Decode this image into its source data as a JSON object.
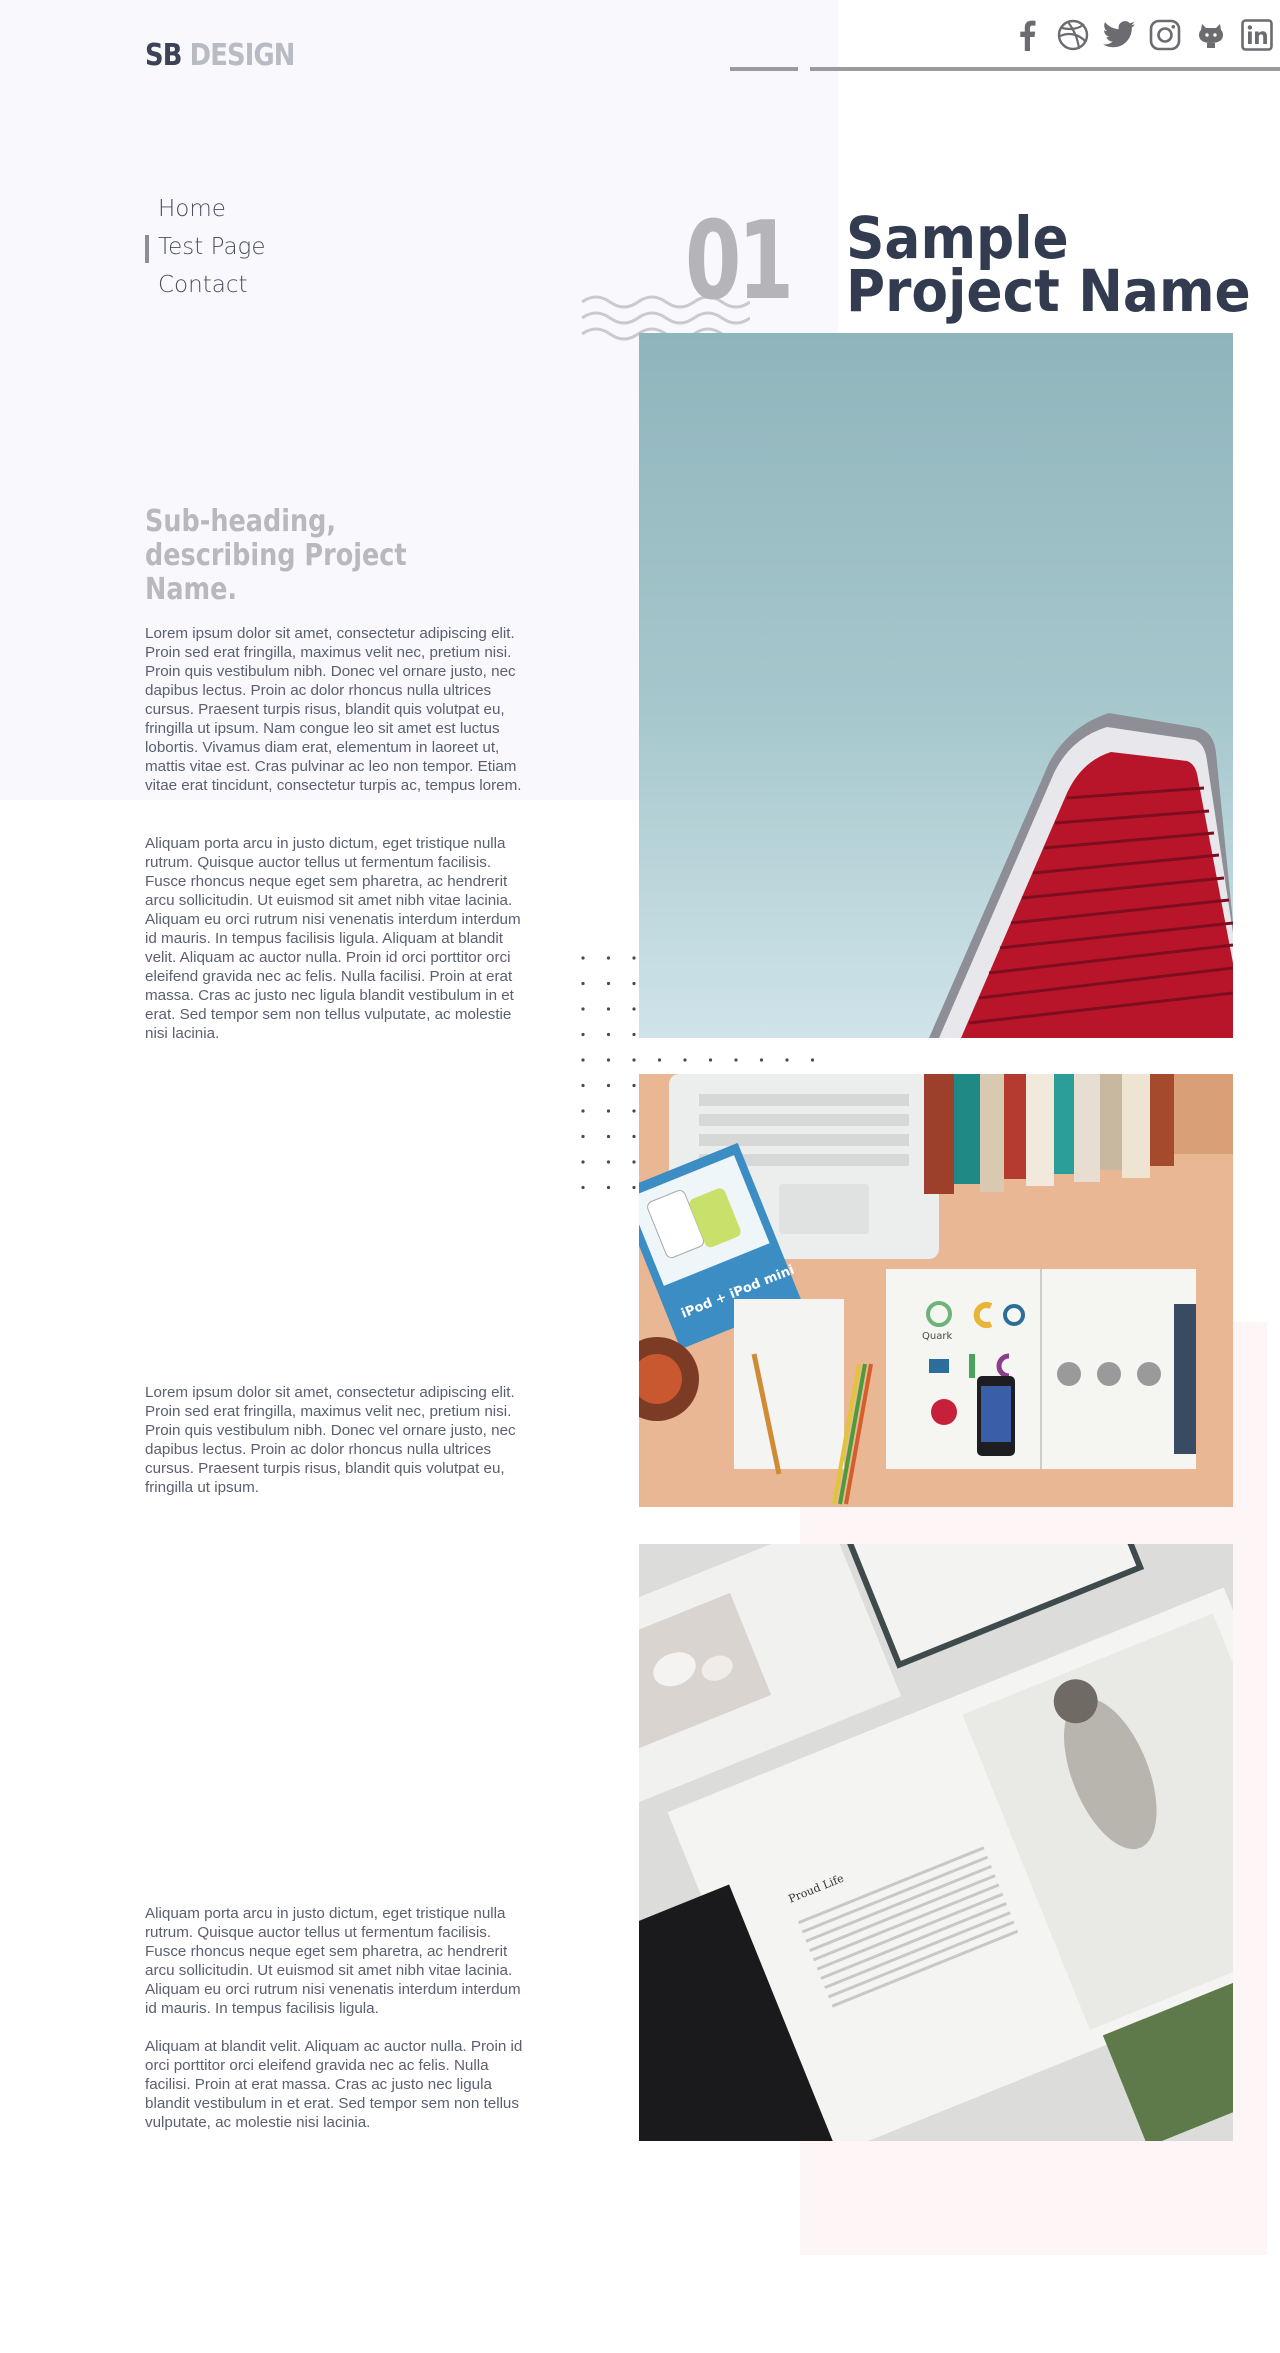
{
  "brand": {
    "sb": "SB",
    "design": "DESIGN"
  },
  "social": [
    {
      "name": "facebook-icon"
    },
    {
      "name": "dribbble-icon"
    },
    {
      "name": "twitter-icon"
    },
    {
      "name": "instagram-icon"
    },
    {
      "name": "github-icon"
    },
    {
      "name": "linkedin-icon"
    }
  ],
  "nav": {
    "items": [
      {
        "label": "Home",
        "active": false
      },
      {
        "label": "Test Page",
        "active": true
      },
      {
        "label": "Contact",
        "active": false
      }
    ]
  },
  "project": {
    "number": "01",
    "title_line1": "Sample",
    "title_line2": "Project Name",
    "subheading": "Sub-heading, describing Project Name."
  },
  "paragraphs": {
    "p1": "Lorem ipsum dolor sit amet, consectetur adipiscing elit. Proin sed erat fringilla, maximus velit nec, pretium nisi. Proin quis vestibulum nibh. Donec vel ornare justo, nec dapibus lectus. Proin ac dolor rhoncus nulla ultrices cursus. Praesent turpis risus, blandit quis volutpat eu, fringilla ut ipsum. Nam congue leo sit amet est luctus lobortis. Vivamus diam erat, elementum in laoreet ut, mattis vitae est. Cras pulvinar ac leo non tempor. Etiam vitae erat tincidunt, consectetur turpis ac, tempus lorem.",
    "p2": "Aliquam porta arcu in justo dictum, eget tristique nulla rutrum. Quisque auctor tellus ut fermentum facilisis. Fusce rhoncus neque eget sem pharetra, ac hendrerit arcu sollicitudin. Ut euismod sit amet nibh vitae lacinia. Aliquam eu orci rutrum nisi venenatis interdum interdum id mauris. In tempus facilisis ligula. Aliquam at blandit velit. Aliquam ac auctor nulla. Proin id orci porttitor orci eleifend gravida nec ac felis. Nulla facilisi. Proin at erat massa. Cras ac justo nec ligula blandit vestibulum in et erat. Sed tempor sem non tellus vulputate, ac molestie nisi lacinia.",
    "p3": "Lorem ipsum dolor sit amet, consectetur adipiscing elit. Proin sed erat fringilla, maximus velit nec, pretium nisi. Proin quis vestibulum nibh. Donec vel ornare justo, nec dapibus lectus. Proin ac dolor rhoncus nulla ultrices cursus. Praesent turpis risus, blandit quis volutpat eu, fringilla ut ipsum.",
    "p4": "Aliquam porta arcu in justo dictum, eget tristique nulla rutrum. Quisque auctor tellus ut fermentum facilisis. Fusce rhoncus neque eget sem pharetra, ac hendrerit arcu sollicitudin. Ut euismod sit amet nibh vitae lacinia. Aliquam eu orci rutrum nisi venenatis interdum interdum id mauris. In tempus facilisis ligula.",
    "p5": "Aliquam at blandit velit. Aliquam ac auctor nulla. Proin id orci porttitor orci eleifend gravida nec ac felis. Nulla facilisi. Proin at erat massa. Cras ac justo nec ligula blandit vestibulum in et erat. Sed tempor sem non tellus vulputate, ac molestie nisi lacinia."
  },
  "images": {
    "img2_labels": {
      "ipod": "iPod + iPod mini",
      "quark": "Quark"
    },
    "img3_labels": {
      "doc_title": "Proud Life"
    }
  },
  "colors": {
    "title": "#323b4f",
    "muted": "#b5b5b9",
    "panel_left": "#f8f8fd",
    "panel_right": "#fdf5f6",
    "building_red": "#c0142c"
  }
}
